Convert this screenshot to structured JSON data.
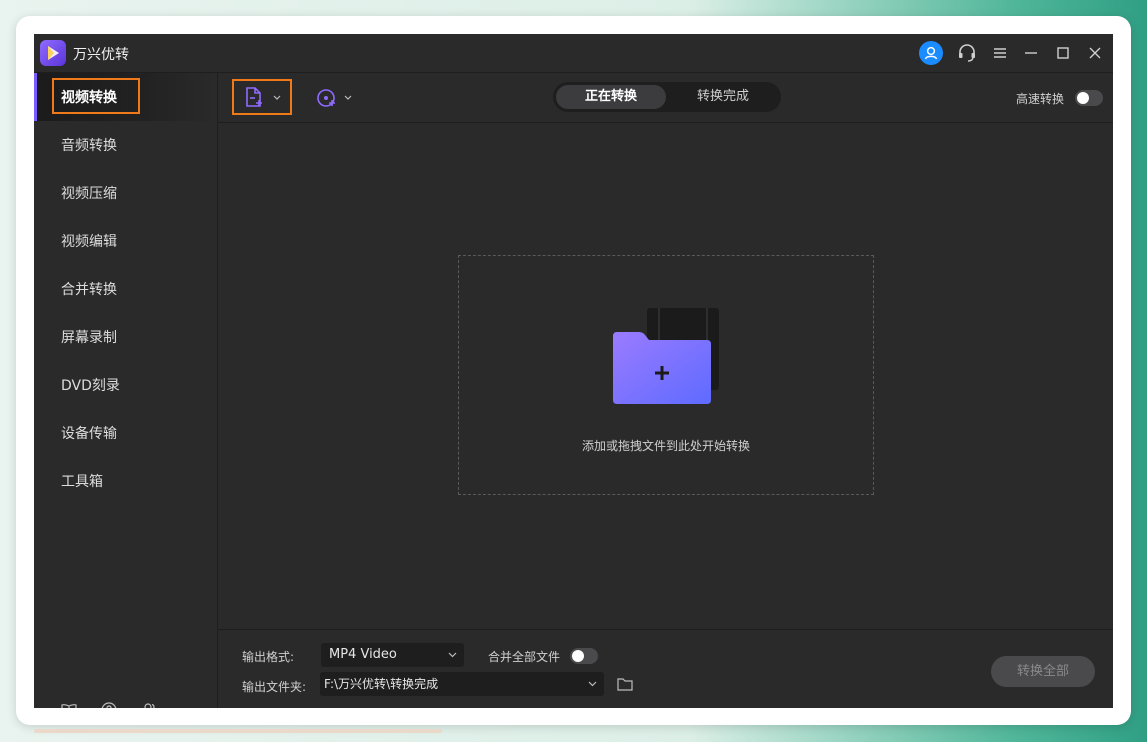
{
  "app": {
    "title": "万兴优转"
  },
  "sidebar": {
    "items": [
      {
        "label": "视频转换",
        "active": true
      },
      {
        "label": "音频转换"
      },
      {
        "label": "视频压缩"
      },
      {
        "label": "视频编辑"
      },
      {
        "label": "合并转换"
      },
      {
        "label": "屏幕录制"
      },
      {
        "label": "DVD刻录"
      },
      {
        "label": "设备传输"
      },
      {
        "label": "工具箱"
      }
    ],
    "bottom_icons": [
      "book-icon",
      "help-icon",
      "users-icon"
    ]
  },
  "toolbar": {
    "tabs": [
      {
        "label": "正在转换",
        "active": true
      },
      {
        "label": "转换完成"
      }
    ],
    "speed_label": "高速转换",
    "speed_on": false
  },
  "dropzone": {
    "text": "添加或拖拽文件到此处开始转换"
  },
  "footer": {
    "format_label": "输出格式:",
    "format_value": "MP4 Video",
    "merge_label": "合并全部文件",
    "merge_on": false,
    "folder_label": "输出文件夹:",
    "folder_value": "F:\\万兴优转\\转换完成",
    "convert_all": "转换全部"
  },
  "colors": {
    "accent": "#7c5cff",
    "highlight": "#f07a1a",
    "user": "#1a8cff"
  }
}
